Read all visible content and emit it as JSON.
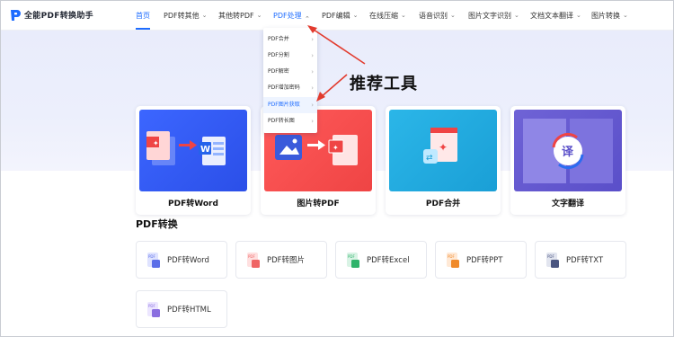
{
  "header": {
    "brand": "全能PDF转换助手",
    "nav": [
      {
        "label": "首页",
        "active": true,
        "has_menu": false
      },
      {
        "label": "PDF转其他",
        "has_menu": true
      },
      {
        "label": "其他转PDF",
        "has_menu": true
      },
      {
        "label": "PDF处理",
        "has_menu": true,
        "open": true
      },
      {
        "label": "PDF编辑",
        "has_menu": true
      },
      {
        "label": "在线压缩",
        "has_menu": true
      },
      {
        "label": "语音识别",
        "has_menu": true
      },
      {
        "label": "图片文字识别",
        "has_menu": true
      },
      {
        "label": "文档文本翻译",
        "has_menu": true
      },
      {
        "label": "图片转换",
        "has_menu": true
      }
    ]
  },
  "dropdown": {
    "items": [
      "PDF合并",
      "PDF分割",
      "PDF解密",
      "PDF增加密码",
      "PDF图片获取",
      "PDF转长图"
    ],
    "highlighted": "PDF图片获取"
  },
  "hero": {
    "title": "推荐工具"
  },
  "cards": [
    {
      "label": "PDF转Word"
    },
    {
      "label": "图片转PDF"
    },
    {
      "label": "PDF合并"
    },
    {
      "label": "文字翻译",
      "art_glyph": "译"
    }
  ],
  "section": {
    "title": "PDF转换"
  },
  "tools": [
    {
      "label": "PDF转Word",
      "color": "#5b6ee8"
    },
    {
      "label": "PDF转图片",
      "color": "#ef6464"
    },
    {
      "label": "PDF转Excel",
      "color": "#2fb36b"
    },
    {
      "label": "PDF转PPT",
      "color": "#f08a2a"
    },
    {
      "label": "PDF转TXT",
      "color": "#4a5580"
    },
    {
      "label": "PDF转HTML",
      "color": "#8a6ee0"
    }
  ],
  "colors": {
    "accent": "#1e6cff",
    "annotation": "#e23b2e"
  }
}
